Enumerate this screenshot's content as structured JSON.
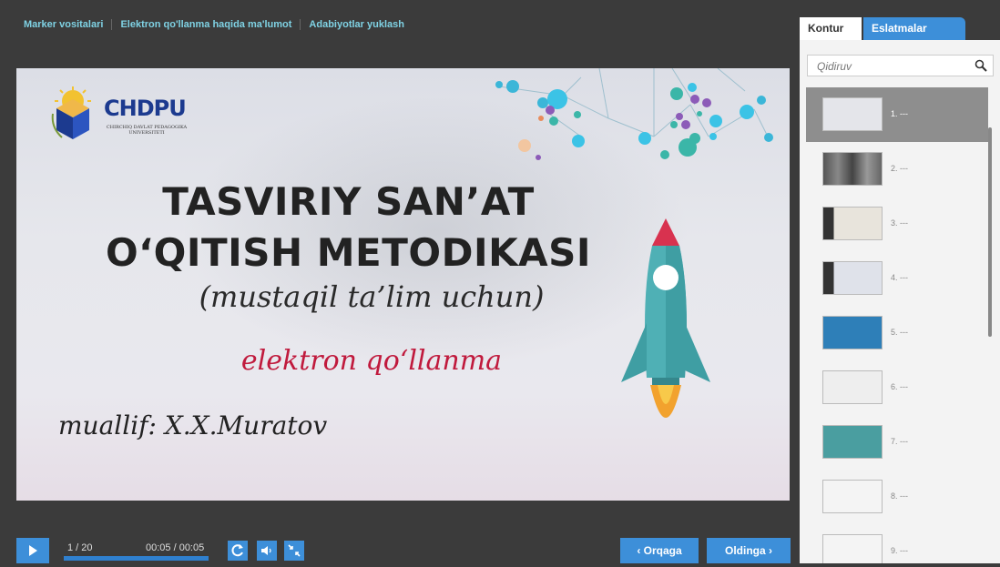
{
  "topnav": {
    "items": [
      "Marker vositalari",
      "Elektron qo'llanma haqida ma'lumot",
      "Adabiyotlar yuklash"
    ]
  },
  "slide": {
    "logo_text": "CHDPU",
    "logo_sub": "CHIRCHIQ DAVLAT PEDAGOGIKA UNIVERSITETI",
    "title_line1": "TASVIRIY SAN’AT",
    "title_line2": "O‘QITISH METODIKASI",
    "subtitle": "(mustaqil ta’lim uchun)",
    "red_title": "elektron qo‘llanma",
    "author": "muallif: X.X.Muratov"
  },
  "player": {
    "counter": "1 / 20",
    "time": "00:05 / 00:05",
    "progress": 1.0,
    "prev_label": "‹ Orqaga",
    "next_label": "Oldinga ›",
    "icons": [
      "play-icon",
      "replay-icon",
      "volume-icon",
      "fullscreen-exit-icon"
    ]
  },
  "panel": {
    "tabs": [
      "Kontur",
      "Eslatmalar"
    ],
    "search_placeholder": "Qidiruv",
    "thumbnails": [
      {
        "label": "1. ---"
      },
      {
        "label": "2. ---"
      },
      {
        "label": "3. ---"
      },
      {
        "label": "4. ---"
      },
      {
        "label": "5. ---"
      },
      {
        "label": "6. ---"
      },
      {
        "label": "7. ---"
      },
      {
        "label": "8. ---"
      },
      {
        "label": "9. ---"
      }
    ]
  },
  "colors": {
    "accent": "#3d8fd9",
    "topnav_text": "#7fd2e4",
    "red_title": "#c01a3d",
    "background": "#3b3b3b"
  }
}
